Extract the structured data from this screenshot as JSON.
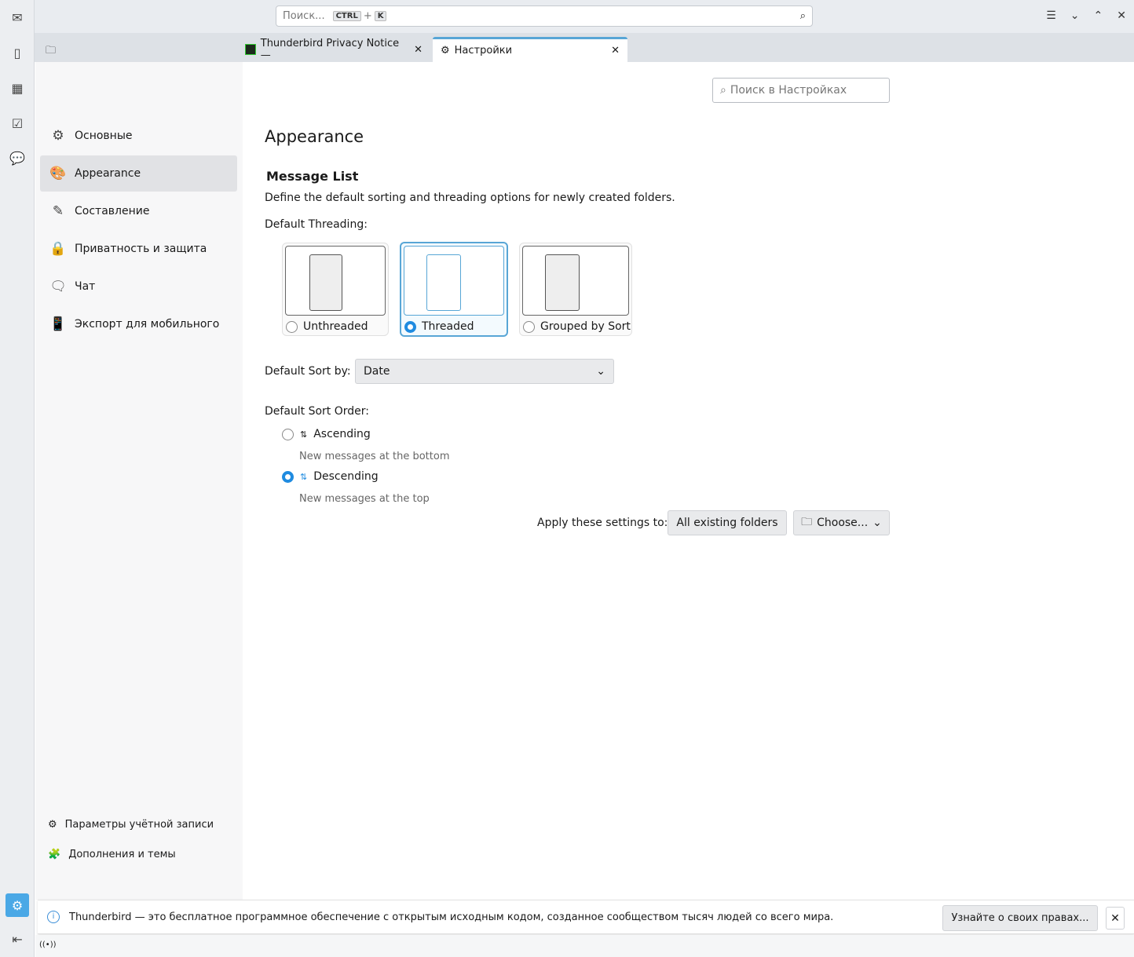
{
  "spaces": {
    "items": [
      {
        "icon": "mail-icon"
      },
      {
        "icon": "address-book-icon"
      },
      {
        "icon": "calendar-icon"
      },
      {
        "icon": "tasks-icon"
      },
      {
        "icon": "chat-icon"
      }
    ],
    "settings_icon": "gear-icon",
    "collapse_icon": "collapse-icon"
  },
  "search": {
    "placeholder": "Поиск...",
    "key1": "CTRL",
    "plus": "+",
    "key2": "K"
  },
  "tabs": [
    {
      "label": "Thunderbird Privacy Notice —"
    },
    {
      "label": "Настройки"
    }
  ],
  "sidebar": {
    "items": [
      {
        "label": "Основные",
        "icon": "gear-icon"
      },
      {
        "label": "Appearance",
        "icon": "palette-icon",
        "selected": true
      },
      {
        "label": "Составление",
        "icon": "pencil-icon"
      },
      {
        "label": "Приватность и защита",
        "icon": "lock-icon"
      },
      {
        "label": "Чат",
        "icon": "chat-icon"
      },
      {
        "label": "Экспорт для мобильного",
        "icon": "mobile-export-icon"
      }
    ],
    "bottom": [
      {
        "label": "Параметры учётной записи",
        "icon": "account-icon"
      },
      {
        "label": "Дополнения и темы",
        "icon": "puzzle-icon"
      }
    ]
  },
  "main": {
    "search_placeholder": "Поиск в Настройках",
    "title": "Appearance",
    "section": "Message List",
    "description": "Define the default sorting and threading options for newly created folders.",
    "threading_label": "Default Threading:",
    "threading_options": [
      {
        "label": "Unthreaded",
        "selected": false
      },
      {
        "label": "Threaded",
        "selected": true
      },
      {
        "label": "Grouped by Sort",
        "selected": false
      }
    ],
    "sort_by_label": "Default Sort by:",
    "sort_by_value": "Date",
    "sort_order_label": "Default Sort Order:",
    "sort_orders": [
      {
        "label": "Ascending",
        "hint": "New messages at the bottom",
        "selected": false
      },
      {
        "label": "Descending",
        "hint": "New messages at the top",
        "selected": true
      }
    ],
    "apply_label": "Apply these settings to:",
    "all_folders": "All existing folders",
    "choose": "Choose..."
  },
  "notification": {
    "text": "Thunderbird — это бесплатное программное обеспечение с открытым исходным кодом, созданное сообществом тысяч людей со всего мира.",
    "button": "Узнайте о своих правах..."
  },
  "colors": {
    "accent": "#58a6d6",
    "radio": "#1f8be0"
  }
}
